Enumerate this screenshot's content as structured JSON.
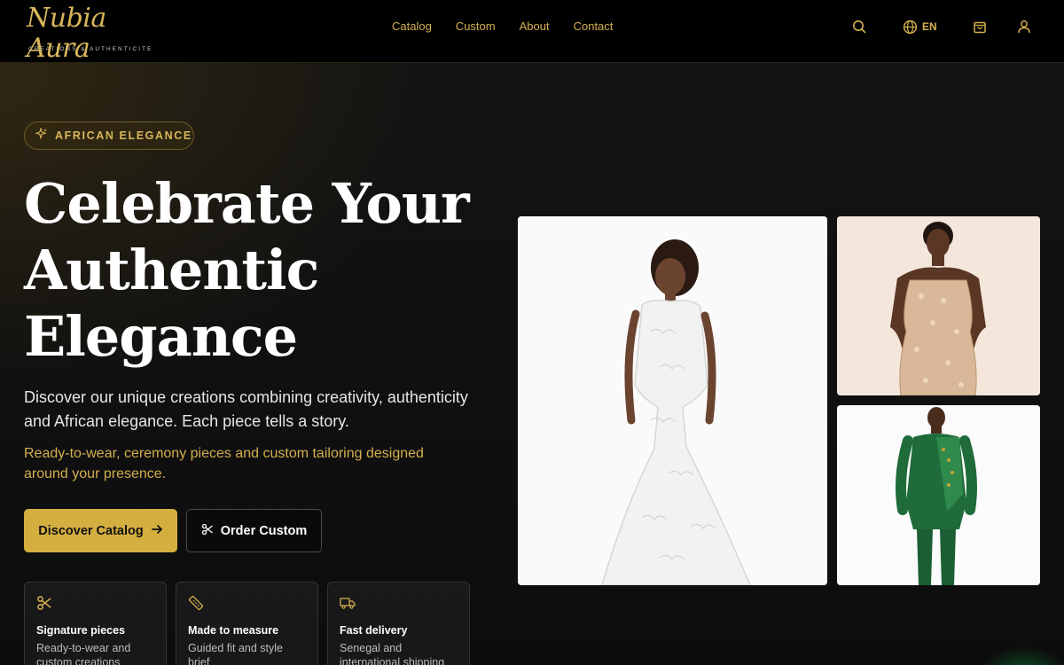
{
  "brand": {
    "name": "Nubia Aura",
    "tagline": "CREATIONS & AUTHENTICITE"
  },
  "nav": {
    "items": [
      {
        "label": "Catalog"
      },
      {
        "label": "Custom"
      },
      {
        "label": "About"
      },
      {
        "label": "Contact"
      }
    ]
  },
  "header_actions": {
    "search_icon": "search-icon",
    "language": "EN",
    "cart_icon": "shopping-bag-icon",
    "account_icon": "user-icon"
  },
  "hero": {
    "badge": "AFRICAN ELEGANCE",
    "title_lines": [
      "Celebrate Your",
      "Authentic",
      "Elegance"
    ],
    "description": "Discover our unique creations combining creativity, authenticity and African elegance. Each piece tells a story.",
    "subtext": "Ready-to-wear, ceremony pieces and custom tailoring designed around your presence.",
    "primary_button": "Discover Catalog",
    "secondary_button": "Order Custom"
  },
  "features": [
    {
      "icon": "scissors-icon",
      "title": "Signature pieces",
      "desc": "Ready-to-wear and custom creations"
    },
    {
      "icon": "ruler-icon",
      "title": "Made to measure",
      "desc": "Guided fit and style brief"
    },
    {
      "icon": "truck-icon",
      "title": "Fast delivery",
      "desc": "Senegal and international shipping"
    }
  ],
  "colors": {
    "accent": "#d4af3f",
    "background": "#111111",
    "header": "#000000"
  }
}
